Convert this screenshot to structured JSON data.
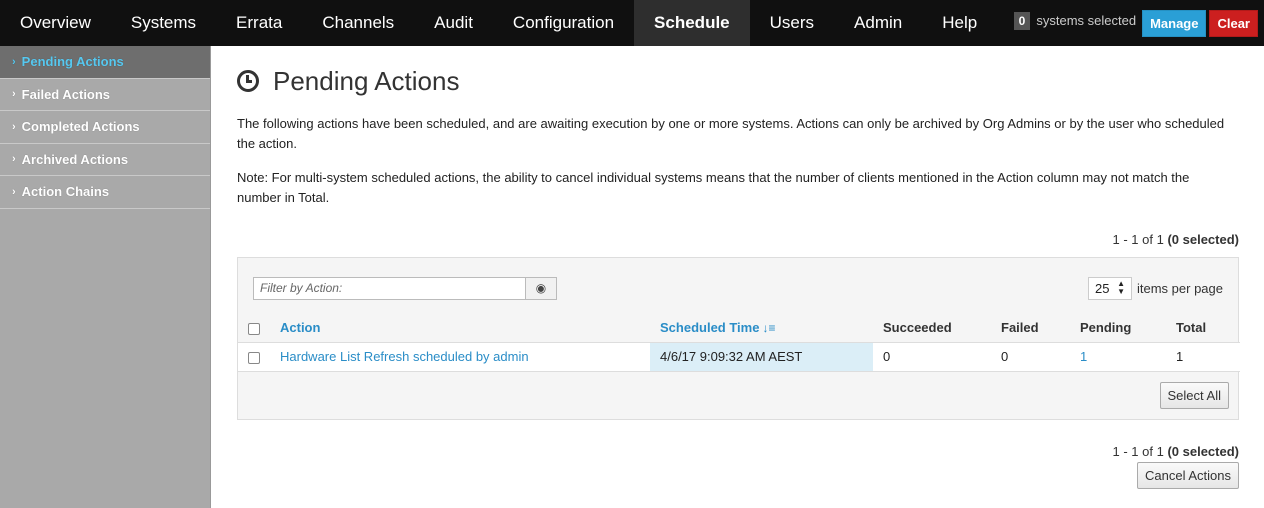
{
  "nav": {
    "items": [
      "Overview",
      "Systems",
      "Errata",
      "Channels",
      "Audit",
      "Configuration",
      "Schedule",
      "Users",
      "Admin",
      "Help"
    ],
    "active_index": 6,
    "systems_selected_count": "0",
    "systems_selected_label": "systems selected",
    "manage_label": "Manage",
    "clear_label": "Clear"
  },
  "sidebar": {
    "items": [
      {
        "label": "Pending Actions",
        "active": true
      },
      {
        "label": "Failed Actions",
        "active": false
      },
      {
        "label": "Completed Actions",
        "active": false
      },
      {
        "label": "Archived Actions",
        "active": false
      },
      {
        "label": "Action Chains",
        "active": false
      }
    ]
  },
  "page": {
    "title": "Pending Actions",
    "title_icon": "clock-icon",
    "description": "The following actions have been scheduled, and are awaiting execution by one or more systems. Actions can only be archived by Org Admins or by the user who scheduled the action.",
    "note": "Note: For multi-system scheduled actions, the ability to cancel individual systems means that the number of clients mentioned in the Action column may not match the number in Total.",
    "pager_range": "1 - 1 of 1",
    "pager_selected": "(0 selected)"
  },
  "table": {
    "filter_placeholder": "Filter by Action:",
    "per_page_value": "25",
    "per_page_label": "items per page",
    "columns": [
      "Action",
      "Scheduled Time",
      "Succeeded",
      "Failed",
      "Pending",
      "Total"
    ],
    "rows": [
      {
        "action": "Hardware List Refresh scheduled by admin",
        "scheduled_time": "4/6/17 9:09:32 AM AEST",
        "succeeded": "0",
        "failed": "0",
        "pending": "1",
        "total": "1"
      }
    ],
    "select_all_label": "Select All"
  },
  "footer": {
    "cancel_label": "Cancel Actions"
  },
  "colors": {
    "accent": "#2a8dc7",
    "sidebar_active_text": "#56c8f0",
    "manage_bg": "#2a9fd6",
    "clear_bg": "#cc1f1f"
  }
}
